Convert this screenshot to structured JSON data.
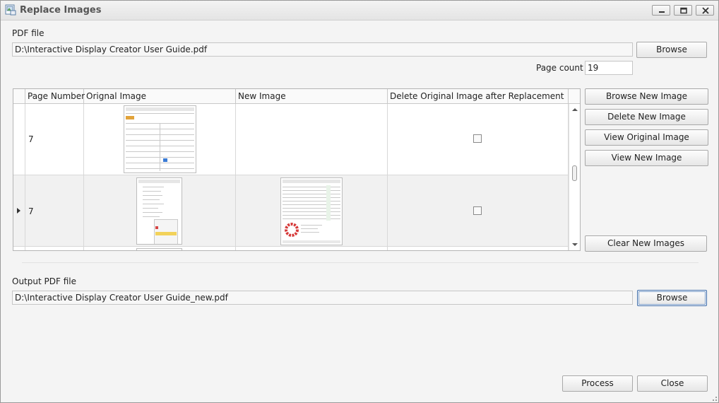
{
  "window": {
    "title": "Replace Images"
  },
  "pdf_file": {
    "label": "PDF file",
    "value": "D:\\Interactive Display Creator User Guide.pdf",
    "browse_label": "Browse"
  },
  "page_count": {
    "label": "Page count",
    "value": "19"
  },
  "table": {
    "columns": [
      "Page Number",
      "Orignal Image",
      "New Image",
      "Delete Original Image after Replacement"
    ],
    "rows": [
      {
        "page_number": "7",
        "original_image_icon": "properties-panel-thumbnail",
        "new_image_icon": "",
        "delete_original": false
      },
      {
        "page_number": "7",
        "original_image_icon": "tree-menu-thumbnail",
        "new_image_icon": "table-chart-thumbnail",
        "delete_original": false
      }
    ]
  },
  "side_buttons": {
    "browse_new_image": "Browse New Image",
    "delete_new_image": "Delete New Image",
    "view_original_image": "View Original Image",
    "view_new_image": "View New Image",
    "clear_new_images": "Clear New Images"
  },
  "output_pdf": {
    "label": "Output PDF file",
    "value": "D:\\Interactive Display Creator User Guide_new.pdf",
    "browse_label": "Browse"
  },
  "footer": {
    "process_label": "Process",
    "close_label": "Close"
  }
}
